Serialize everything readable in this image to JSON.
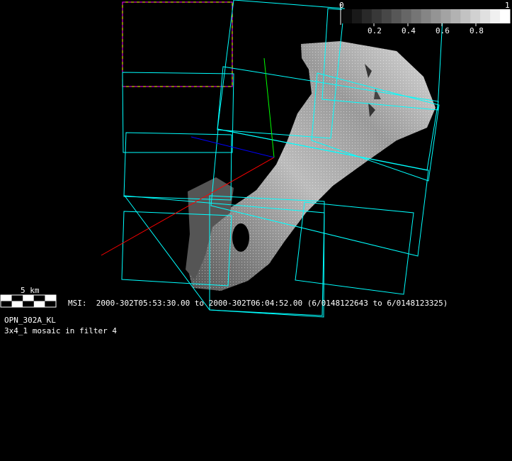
{
  "colorbar": {
    "min_label": "0",
    "max_label": "1",
    "tick_labels": [
      "0.2",
      "0.4",
      "0.6",
      "0.8"
    ],
    "colormap": "grayscale",
    "steps": 17
  },
  "scale_bar": {
    "label": "5 km"
  },
  "info": {
    "msi_line": "MSI:  2000-302T05:53:30.00 to 2000-302T06:04:52.00 (6/0148122643 to 6/0148123325)",
    "observation_id": "OPN_302A_KL",
    "description": "3x4_1 mosaic in filter 4"
  },
  "colors": {
    "footprint": "#00ffff",
    "selection_dash_a": "#ff00ff",
    "selection_dash_b": "#ffff00",
    "axis_x": "#ff0000",
    "axis_y": "#00ff00",
    "axis_z": "#0000ff",
    "background": "#000000"
  }
}
